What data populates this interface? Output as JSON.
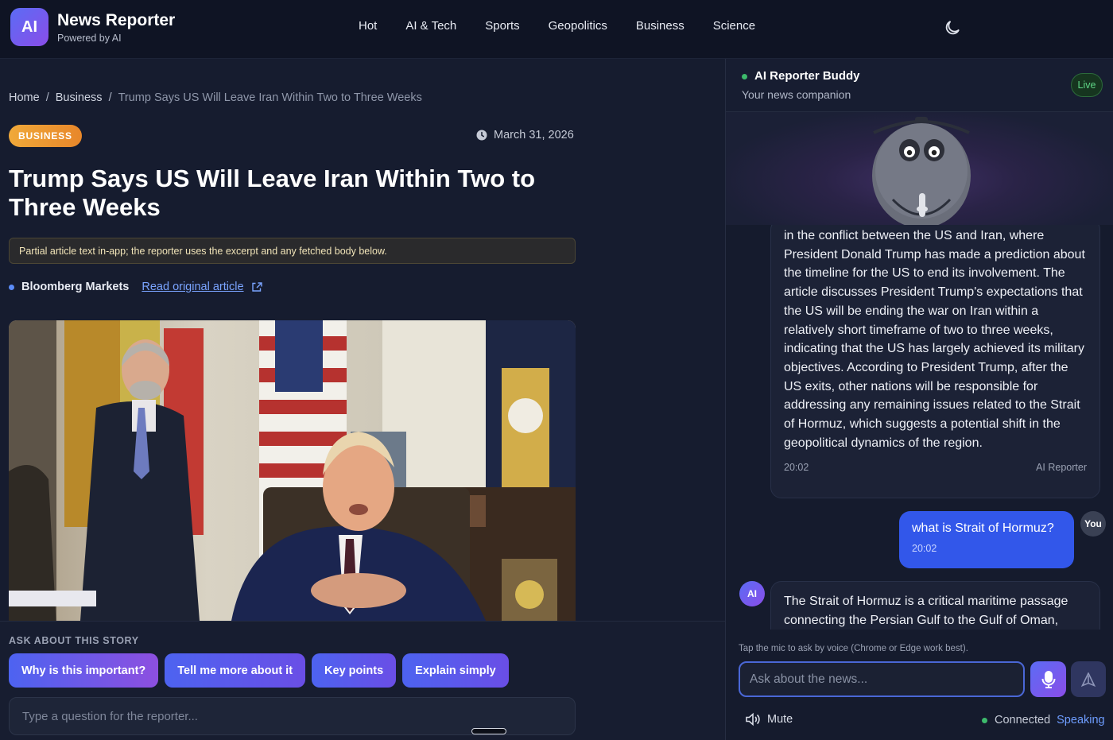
{
  "header": {
    "logo_text": "AI",
    "title": "News Reporter",
    "subtitle": "Powered by AI",
    "nav": [
      "Hot",
      "AI & Tech",
      "Sports",
      "Geopolitics",
      "Business",
      "Science"
    ],
    "theme_icon": "moon-icon"
  },
  "article": {
    "breadcrumb": {
      "home": "Home",
      "section": "Business",
      "current": "Trump Says US Will Leave Iran Within Two to Three Weeks",
      "separator": "/"
    },
    "category": "BUSINESS",
    "date": "March 31, 2026",
    "headline": "Trump Says US Will Leave Iran Within Two to Three Weeks",
    "notice": "Partial article text in-app; the reporter uses the excerpt and any fetched body below.",
    "source": "Bloomberg Markets",
    "read_link": "Read original article"
  },
  "ask": {
    "label": "ASK ABOUT THIS STORY",
    "chips": [
      "Why is this important?",
      "Tell me more about it",
      "Key points",
      "Explain simply"
    ],
    "input_placeholder": "Type a question for the reporter..."
  },
  "chat": {
    "title": "AI Reporter Buddy",
    "subtitle": "Your news companion",
    "live": "Live",
    "messages": [
      {
        "text": "in the conflict between the US and Iran, where President Donald Trump has made a prediction about the timeline for the US to end its involvement. The article discusses President Trump's expectations that the US will be ending the war on Iran within a relatively short timeframe of two to three weeks, indicating that the US has largely achieved its military objectives. According to President Trump, after the US exits, other nations will be responsible for addressing any remaining issues related to the Strait of Hormuz, which suggests a potential shift in the geopolitical dynamics of the region.",
        "time": "20:02",
        "author": "AI Reporter"
      },
      {
        "text": "what is Strait of Hormuz?",
        "time": "20:02",
        "author": "You"
      },
      {
        "text": "The Strait of Hormuz is a critical maritime passage connecting the Persian Gulf to the Gulf of Oman,",
        "avatar": "AI"
      }
    ],
    "voice_hint": "Tap the mic to ask by voice (Chrome or Edge work best).",
    "input_placeholder": "Ask about the news...",
    "mute": "Mute",
    "connected": "Connected",
    "speaking": "Speaking"
  },
  "colors": {
    "accent": "#4d63f0",
    "accent_purple": "#8a4de8",
    "badge_orange": "#f0a93a",
    "live_green": "#3dba6c",
    "user_bubble": "#3257ea"
  }
}
